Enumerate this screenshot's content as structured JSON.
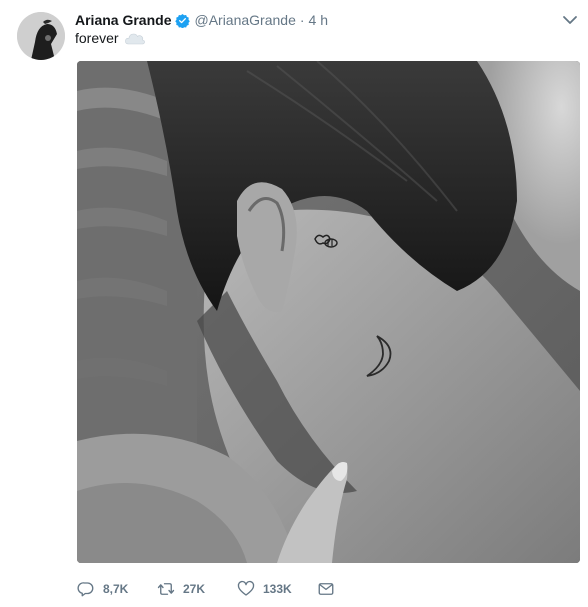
{
  "tweet": {
    "author_name": "Ariana Grande",
    "handle": "@ArianaGrande",
    "separator": "·",
    "time": "4 h",
    "text": "forever",
    "icons": {
      "verified": "verified-badge-icon",
      "caret": "chevron-down-icon",
      "cloud": "cloud-emoji-icon",
      "reply": "reply-icon",
      "retweet": "retweet-icon",
      "like": "heart-icon",
      "dm": "envelope-icon"
    },
    "actions": {
      "reply_count": "8,7K",
      "retweet_count": "27K",
      "like_count": "133K"
    },
    "colors": {
      "verified": "#1da1f2",
      "muted": "#657786",
      "text": "#14171a"
    }
  }
}
